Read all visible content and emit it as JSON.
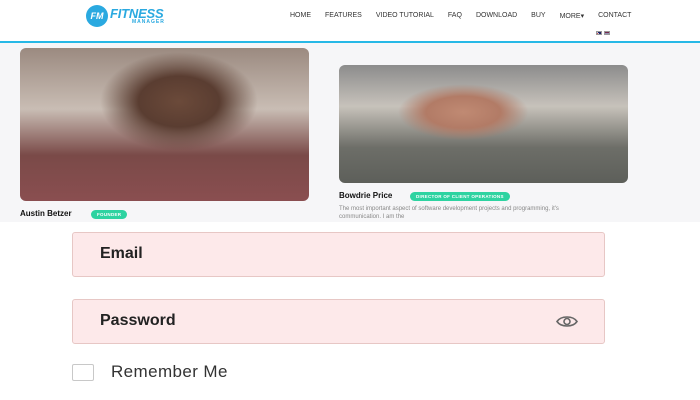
{
  "site": {
    "logo": {
      "badge": "FM",
      "title": "FITNESS",
      "subtitle": "MANAGER"
    },
    "menu": [
      "HOME",
      "FEATURES",
      "VIDEO TUTORIAL",
      "FAQ",
      "DOWNLOAD",
      "BUY",
      "MORE▾",
      "CONTACT"
    ],
    "team": [
      {
        "name": "Austin Betzer",
        "role": "FOUNDER"
      },
      {
        "name": "Bowdrie Price",
        "role": "DIRECTOR OF CLIENT OPERATIONS",
        "bio": "The most important aspect of software development projects and programming, it's communication. I am the"
      }
    ],
    "accent": "#27b8e6",
    "pill_color": "#2ed3a1"
  },
  "login": {
    "email_label": "Email",
    "password_label": "Password",
    "remember_label": "Remember Me",
    "field_bg": "#fde9ea"
  }
}
